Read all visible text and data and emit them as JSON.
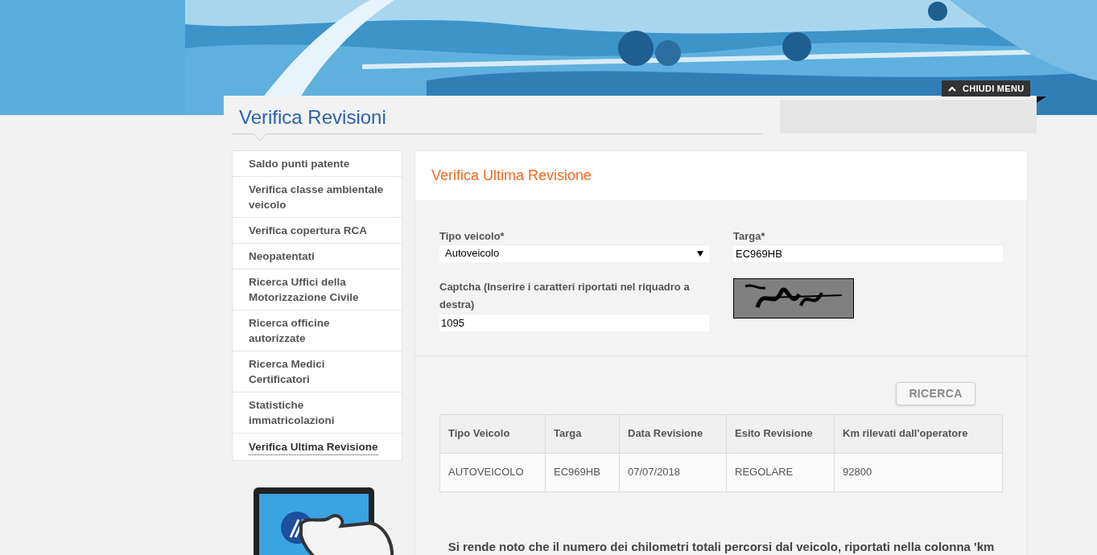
{
  "header": {
    "menu_toggle": "CHIUDI MENU"
  },
  "page_title": "Verifica Revisioni",
  "sidebar": {
    "items": [
      {
        "label": "Saldo punti patente",
        "selected": false
      },
      {
        "label": "Verifica classe ambientale veicolo",
        "selected": false
      },
      {
        "label": "Verifica copertura RCA",
        "selected": false
      },
      {
        "label": "Neopatentati",
        "selected": false
      },
      {
        "label": "Ricerca Uffici della Motorizzazione Civile",
        "selected": false
      },
      {
        "label": "Ricerca officine autorizzate",
        "selected": false
      },
      {
        "label": "Ricerca Medici Certificatori",
        "selected": false
      },
      {
        "label": "Statistiche immatricolazioni",
        "selected": false
      },
      {
        "label": "Verifica Ultima Revisione",
        "selected": true
      }
    ]
  },
  "main": {
    "title": "Verifica Ultima Revisione",
    "form": {
      "vehicle_type": {
        "label": "Tipo veicolo*",
        "value": "Autoveicolo"
      },
      "plate": {
        "label": "Targa*",
        "value": "EC969HB"
      },
      "captcha": {
        "label": "Captcha (Inserire i caratteri riportati nel riquadro a destra)",
        "value": "1095"
      },
      "search_button": "RICERCA"
    },
    "table": {
      "columns": [
        "Tipo Veicolo",
        "Targa",
        "Data Revisione",
        "Esito Revisione",
        "Km rilevati dall'operatore"
      ],
      "rows": [
        [
          "AUTOVEICOLO",
          "EC969HB",
          "07/07/2018",
          "REGOLARE",
          "92800"
        ]
      ]
    },
    "note": "Si rende noto che il numero dei chilometri totali percorsi dal veicolo, riportati nella colonna 'km"
  }
}
